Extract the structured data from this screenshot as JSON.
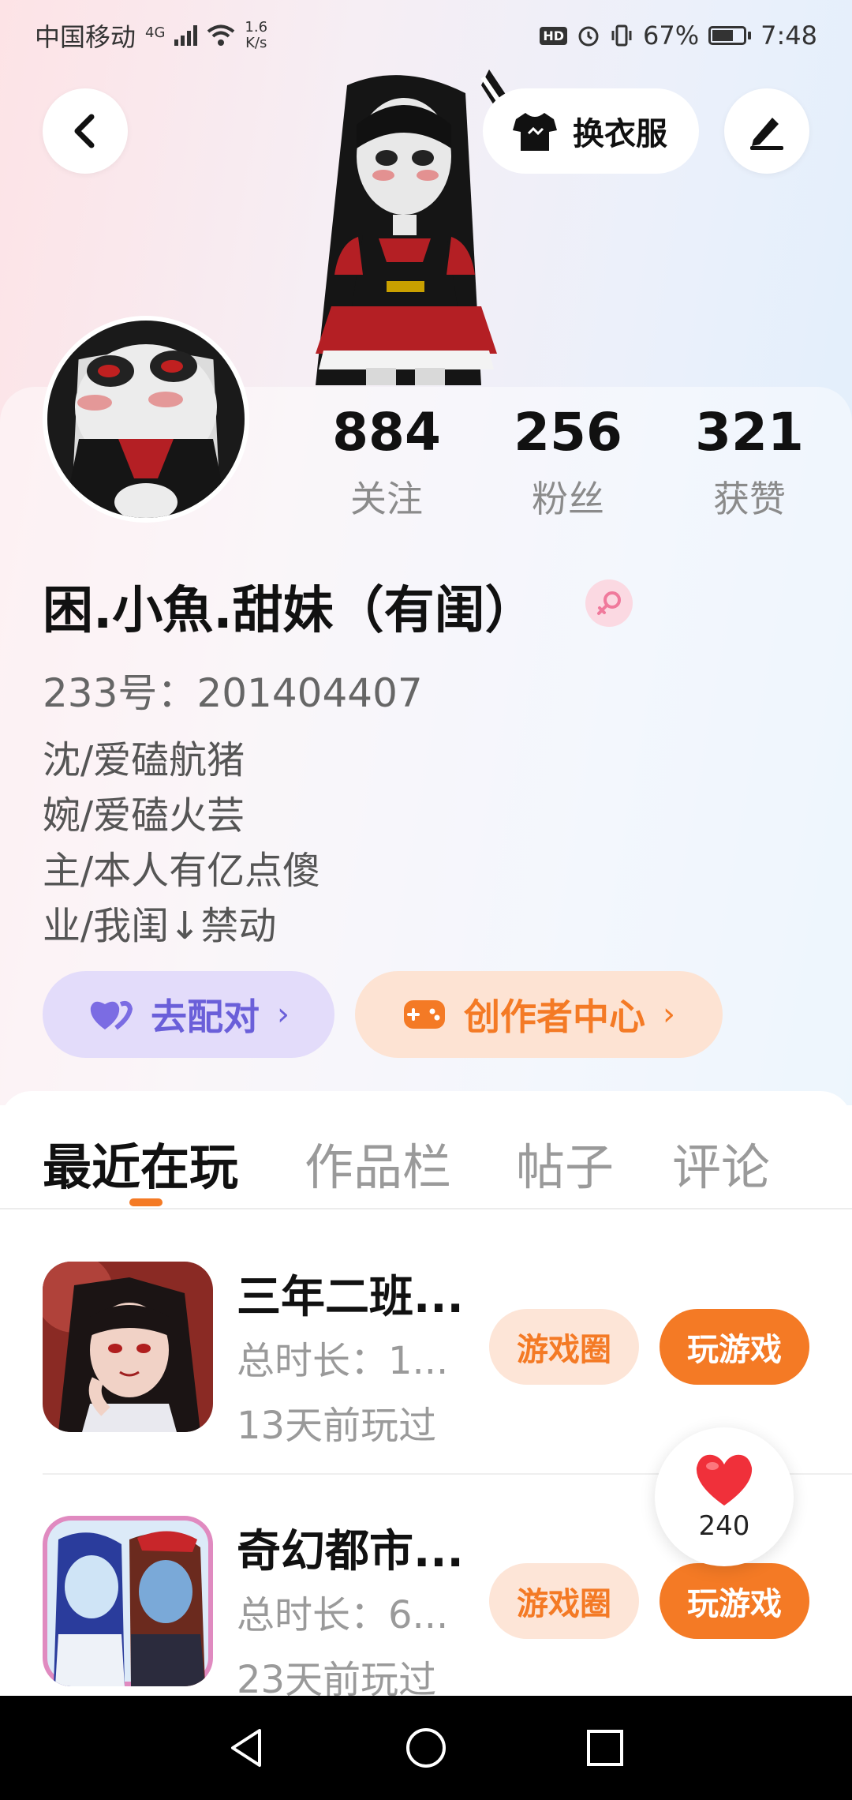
{
  "status_bar": {
    "carrier": "中国移动",
    "network": "4G",
    "speed_value": "1.6",
    "speed_unit": "K/s",
    "hd": "HD",
    "battery": "67%",
    "battery_level": 0.67,
    "time": "7:48"
  },
  "header": {
    "change_outfit_label": "换衣服"
  },
  "stats": [
    {
      "value": "884",
      "label": "关注"
    },
    {
      "value": "256",
      "label": "粉丝"
    },
    {
      "value": "321",
      "label": "获赞"
    }
  ],
  "profile": {
    "nickname": "困.小魚.甜妹（有闺）",
    "id_label": "233号：",
    "id_value": "201404407",
    "bio": [
      "沈/爱磕航猪",
      "婉/爱磕火芸",
      "主/本人有亿点傻",
      "业/我闺↓禁动"
    ]
  },
  "actions": {
    "pair_label": "去配对",
    "creator_label": "创作者中心"
  },
  "tabs": [
    "最近在玩",
    "作品栏",
    "帖子",
    "评论"
  ],
  "games": [
    {
      "title": "三年二班...",
      "duration": "总时长：1...",
      "last_played": "13天前玩过",
      "circle_label": "游戏圈",
      "play_label": "玩游戏"
    },
    {
      "title": "奇幻都市...",
      "duration": "总时长：6...",
      "last_played": "23天前玩过",
      "circle_label": "游戏圈",
      "play_label": "玩游戏"
    }
  ],
  "likes_float": {
    "count": "240"
  },
  "colors": {
    "accent_orange": "#f47a25",
    "pair_purple": "#6a5fd9",
    "female_pink": "#f07a9c"
  }
}
